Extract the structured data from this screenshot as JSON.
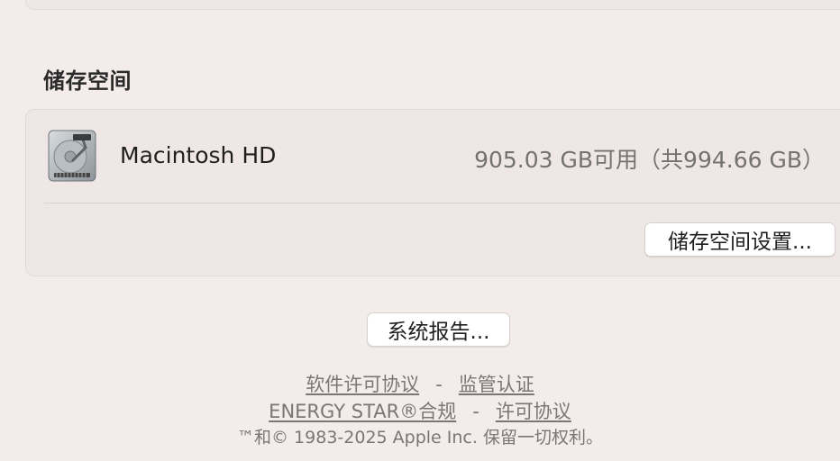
{
  "storage": {
    "title": "储存空间",
    "disk": {
      "name": "Macintosh HD",
      "usage": "905.03 GB可用（共994.66 GB）",
      "icon": "hard-drive-icon"
    },
    "settings_button": "储存空间设置..."
  },
  "system_report_button": "系统报告...",
  "footer": {
    "links_line1": [
      "软件许可协议",
      "监管认证"
    ],
    "links_line2": [
      "ENERGY STAR®合规",
      "许可协议"
    ],
    "separator": "-",
    "copyright": "™和© 1983-2025 Apple Inc. 保留一切权利。"
  },
  "colors": {
    "background": "#f3ecea",
    "card": "#efe7e5",
    "secondary_text": "#747171"
  }
}
